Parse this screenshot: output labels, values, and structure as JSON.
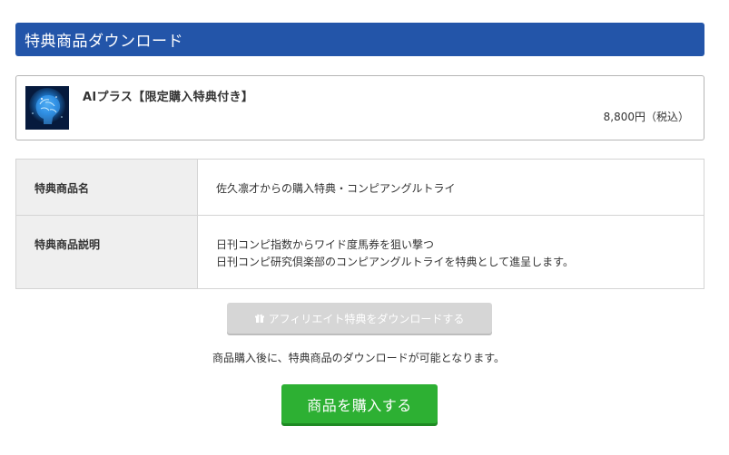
{
  "header": {
    "title": "特典商品ダウンロード"
  },
  "product": {
    "name": "AIプラス【限定購入特典付き】",
    "price": "8,800円（税込）",
    "thumbnail_icon": "brain-thumbnail-icon"
  },
  "details": {
    "rows": [
      {
        "label": "特典商品名",
        "lines": [
          "佐久凛才からの購入特典・コンピアングルトライ"
        ]
      },
      {
        "label": "特典商品説明",
        "lines": [
          "日刊コンピ指数からワイド度馬券を狙い撃つ",
          "日刊コンピ研究倶楽部のコンピアングルトライを特典として進呈します。"
        ]
      }
    ]
  },
  "download_button": {
    "label": "アフィリエイト特典をダウンロードする",
    "icon": "gift-icon",
    "state": "disabled"
  },
  "notice": "商品購入後に、特典商品のダウンロードが可能となります。",
  "buy_button": {
    "label": "商品を購入する"
  },
  "colors": {
    "header_bg": "#2355a9",
    "buy_button_bg": "#2db033",
    "disabled_button_bg": "#d6d6d6",
    "table_label_bg": "#efefef"
  }
}
